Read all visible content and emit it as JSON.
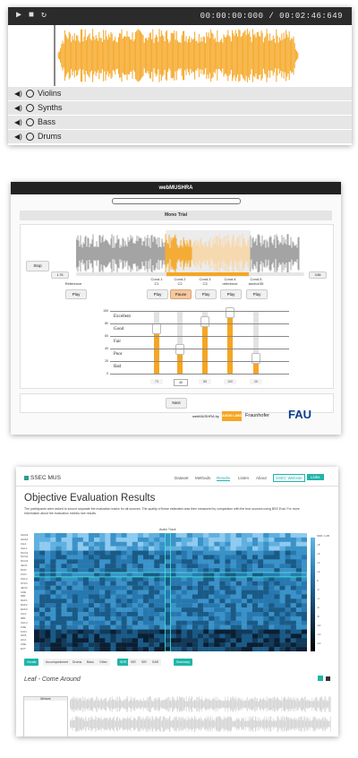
{
  "player": {
    "time_display": "00:00:00:000 / 00:02:46:649",
    "waveform_color": "#f5a623",
    "tracks": [
      {
        "label": "Violins"
      },
      {
        "label": "Synths"
      },
      {
        "label": "Bass"
      },
      {
        "label": "Drums"
      }
    ]
  },
  "mushra": {
    "app_title": "webMUSHRA",
    "trial_title": "Mono Trial",
    "stop_label": "Stop",
    "time_start": "1.76",
    "time_end": "3.86",
    "play_label": "Play",
    "pause_label": "Pause",
    "reference_label": "Reference",
    "conditions": [
      {
        "line1": "Cond.1",
        "line2": "C1",
        "button": "Play",
        "value": "73",
        "rating": 0.73
      },
      {
        "line1": "Cond.2",
        "line2": "C2",
        "button": "Pause",
        "value": "40",
        "rating": 0.4
      },
      {
        "line1": "Cond.3",
        "line2": "C3",
        "button": "Play",
        "value": "85",
        "rating": 0.85
      },
      {
        "line1": "Cond.4",
        "line2": "reference",
        "button": "Play",
        "value": "100",
        "rating": 1.0
      },
      {
        "line1": "Cond.5",
        "line2": "anchor35",
        "button": "Play",
        "value": "26",
        "rating": 0.26
      }
    ],
    "scale": [
      "Excellent",
      "Good",
      "Fair",
      "Poor",
      "Bad"
    ],
    "scale_numbers": [
      "100",
      "80",
      "60",
      "40",
      "20",
      "0"
    ],
    "next_label": "Next",
    "footer_text": "webMUSHRA by",
    "footer_logos": [
      "AUDIO LABS",
      "Fraunhofer",
      "FAU"
    ],
    "accent": "#f5a623"
  },
  "ssec": {
    "logo": "SSEC MUS",
    "nav": [
      "Dataset",
      "Methods",
      "Results",
      "Listen",
      "About"
    ],
    "nav_active": "Results",
    "nav_button": "SSEC Website",
    "nav_link": "Links",
    "title": "Objective Evaluation Results",
    "description": "The participants were asked to source separate the evaluation tracks for all sources. The quality of these estimates was then measured by comparison with the true sources using BSS Eval. For more information about the evaluation metrics see results.",
    "heatmap_header": "Audio Track",
    "colorbar_labels": [
      "SDR in dB",
      "+8",
      "+6",
      "+4",
      "+2",
      "0",
      "-2",
      "-4",
      "-6",
      "-8",
      "-10",
      "-12",
      "-14"
    ],
    "methods": [
      "GRA3",
      "GRA2",
      "CHA",
      "UHL1",
      "NUG1",
      "NUG2",
      "NUG3",
      "JEO1",
      "DUR",
      "KON",
      "UHL2",
      "STO1",
      "JEO2",
      "OZE",
      "IBM",
      "RAF1",
      "RAF2",
      "RAF3",
      "CHA",
      "IBM",
      "UHL3",
      "OZE",
      "KON",
      "GRA",
      "HUA",
      "OZE",
      "EXT"
    ],
    "tabs": [
      "Vocals",
      "Accompaniment",
      "Drums",
      "Bass",
      "Other",
      "SDR",
      "ISR",
      "SIR",
      "SAR",
      "Summary"
    ],
    "tab_active": "Vocals",
    "song_title": "Leaf - Come Around",
    "accent": "#1fb5a8"
  }
}
